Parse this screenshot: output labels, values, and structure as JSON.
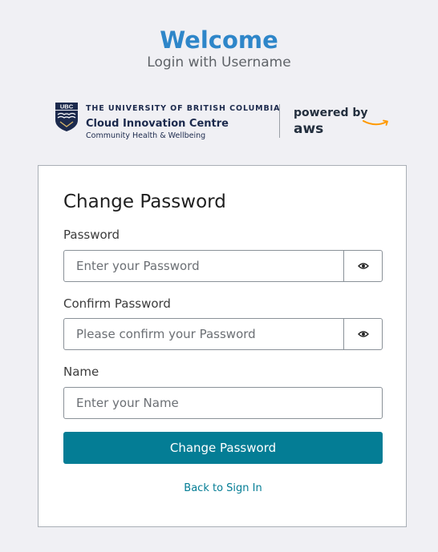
{
  "header": {
    "title": "Welcome",
    "subtitle": "Login with Username"
  },
  "logos": {
    "ubc_badge": "UBC",
    "ubc_line1": "THE UNIVERSITY OF BRITISH COLUMBIA",
    "ubc_line2": "Cloud Innovation Centre",
    "ubc_line3": "Community Health & Wellbeing",
    "powered_by": "powered by",
    "aws": "aws"
  },
  "form": {
    "title": "Change Password",
    "password": {
      "label": "Password",
      "placeholder": "Enter your Password",
      "value": ""
    },
    "confirm_password": {
      "label": "Confirm Password",
      "placeholder": "Please confirm your Password",
      "value": ""
    },
    "name": {
      "label": "Name",
      "placeholder": "Enter your Name",
      "value": ""
    },
    "submit_label": "Change Password",
    "back_link": "Back to Sign In"
  },
  "icons": {
    "show_password": "eye-icon",
    "crest": "ubc-crest-icon",
    "smile": "aws-smile-icon"
  },
  "colors": {
    "accent": "#2e86c9",
    "primary_button": "#047d95",
    "link": "#047d95",
    "background": "#f0f0f4",
    "aws_orange": "#ff9900",
    "ubc_navy": "#1c2a4d"
  }
}
